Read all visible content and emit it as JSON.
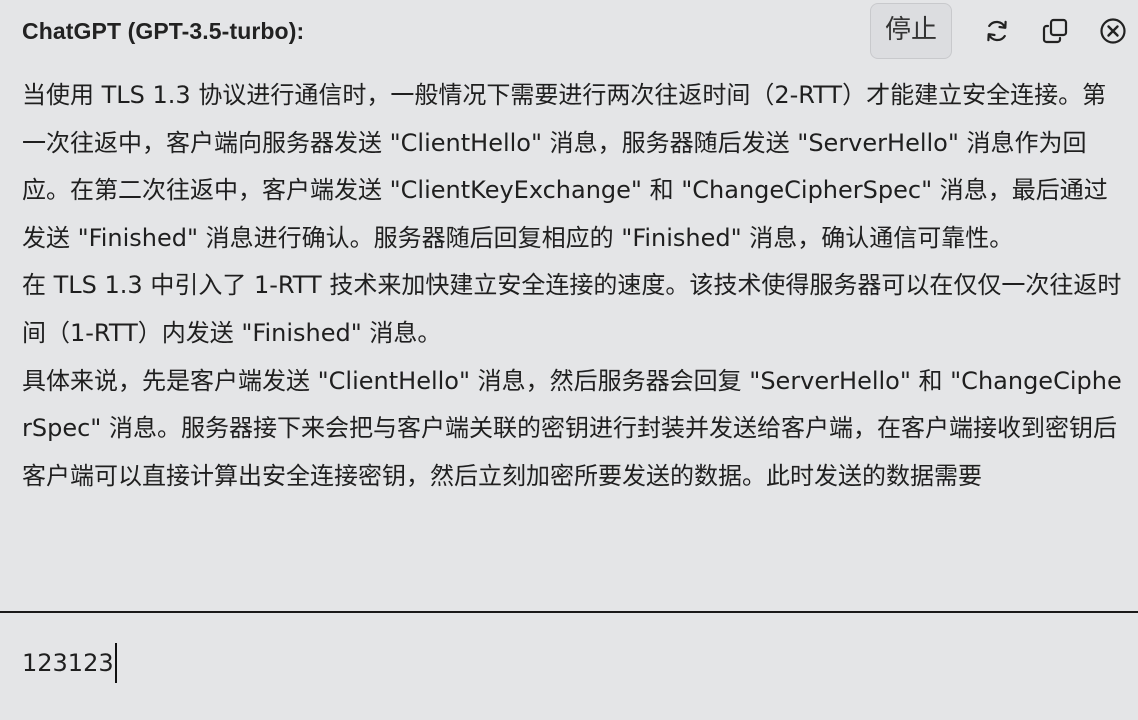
{
  "header": {
    "title": "ChatGPT (GPT-3.5-turbo):",
    "stop_label": "停止",
    "icons": [
      "refresh-icon",
      "copy-icon",
      "close-icon"
    ]
  },
  "message": {
    "paragraphs": [
      "当使用 TLS 1.3 协议进行通信时，一般情况下需要进行两次往返时间（2-RTT）才能建立安全连接。第一次往返中，客户端向服务器发送 \"ClientHello\" 消息，服务器随后发送 \"ServerHello\" 消息作为回应。在第二次往返中，客户端发送 \"ClientKeyExchange\" 和 \"ChangeCipherSpec\" 消息，最后通过发送 \"Finished\" 消息进行确认。服务器随后回复相应的 \"Finished\" 消息，确认通信可靠性。",
      "在 TLS 1.3 中引入了 1-RTT 技术来加快建立安全连接的速度。该技术使得服务器可以在仅仅一次往返时间（1-RTT）内发送 \"Finished\" 消息。",
      "具体来说，先是客户端发送 \"ClientHello\" 消息，然后服务器会回复 \"ServerHello\" 和 \"ChangeCipherSpec\" 消息。服务器接下来会把与客户端关联的密钥进行封装并发送给客户端，在客户端接收到密钥后客户端可以直接计算出安全连接密钥，然后立刻加密所要发送的数据。此时发送的数据需要"
    ]
  },
  "input": {
    "value": "123123"
  }
}
